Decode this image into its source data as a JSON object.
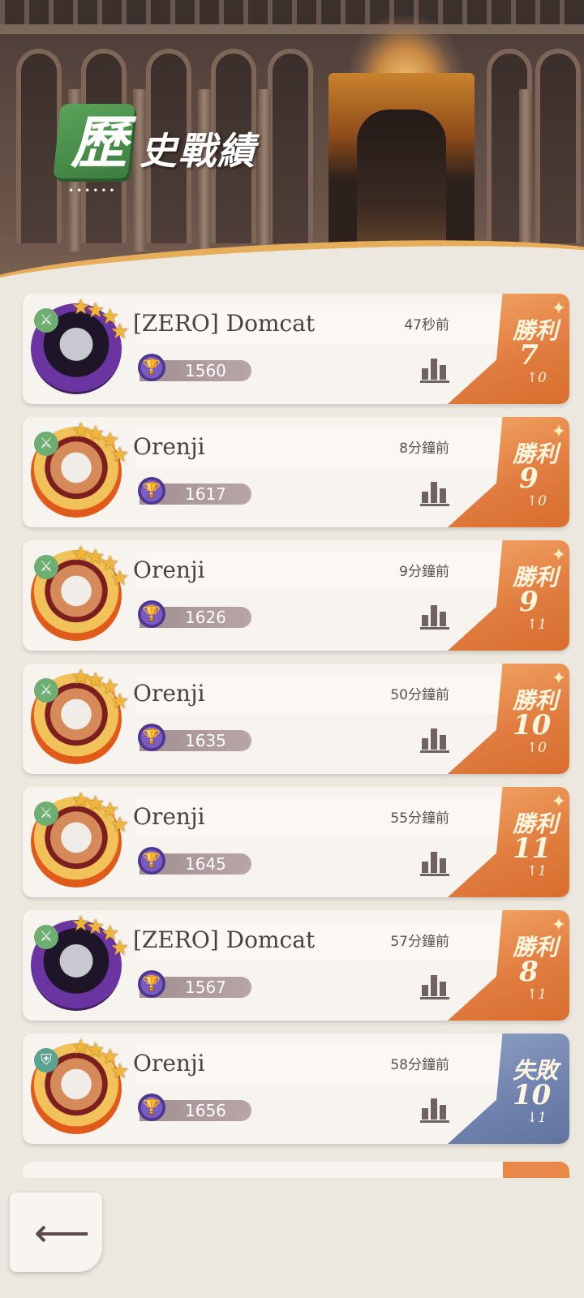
{
  "screen_title": {
    "badge_char": "歷",
    "rest": "史戰績",
    "dots": "••••••"
  },
  "matches": [
    {
      "player": "[ZERO] Domcat",
      "time": "47秒前",
      "rank": "1560",
      "result": "勝利",
      "score": "7",
      "delta": "↑0",
      "outcome": "win",
      "avatar": "purple",
      "mode": "attack"
    },
    {
      "player": "Orenji",
      "time": "8分鐘前",
      "rank": "1617",
      "result": "勝利",
      "score": "9",
      "delta": "↑0",
      "outcome": "win",
      "avatar": "orange",
      "mode": "attack"
    },
    {
      "player": "Orenji",
      "time": "9分鐘前",
      "rank": "1626",
      "result": "勝利",
      "score": "9",
      "delta": "↑1",
      "outcome": "win",
      "avatar": "orange",
      "mode": "attack"
    },
    {
      "player": "Orenji",
      "time": "50分鐘前",
      "rank": "1635",
      "result": "勝利",
      "score": "10",
      "delta": "↑0",
      "outcome": "win",
      "avatar": "orange",
      "mode": "attack"
    },
    {
      "player": "Orenji",
      "time": "55分鐘前",
      "rank": "1645",
      "result": "勝利",
      "score": "11",
      "delta": "↑1",
      "outcome": "win",
      "avatar": "orange",
      "mode": "attack"
    },
    {
      "player": "[ZERO] Domcat",
      "time": "57分鐘前",
      "rank": "1567",
      "result": "勝利",
      "score": "8",
      "delta": "↑1",
      "outcome": "win",
      "avatar": "purple",
      "mode": "attack"
    },
    {
      "player": "Orenji",
      "time": "58分鐘前",
      "rank": "1656",
      "result": "失敗",
      "score": "10",
      "delta": "↓1",
      "outcome": "lose",
      "avatar": "orange",
      "mode": "defend"
    }
  ],
  "icons": {
    "mode_attack": "sword-icon",
    "mode_defend": "shield-icon",
    "rank": "trophy-icon",
    "stats": "bar-chart-icon",
    "back": "back-arrow-icon"
  },
  "colors": {
    "win": "#e07b3e",
    "lose": "#6f82ad",
    "title_badge": "#4a9a4c"
  }
}
